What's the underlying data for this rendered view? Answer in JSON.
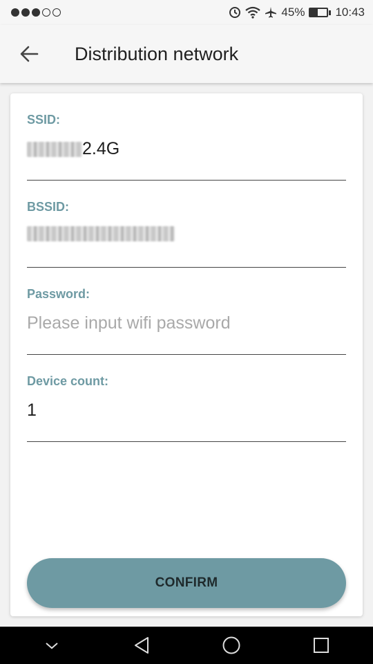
{
  "status_bar": {
    "signal_dots": [
      "filled",
      "filled",
      "filled",
      "empty",
      "empty"
    ],
    "battery_percent": "45%",
    "battery_level": 0.45,
    "time": "10:43",
    "icons": [
      "alarm-icon",
      "wifi-icon",
      "airplane-icon",
      "battery-icon"
    ]
  },
  "app_bar": {
    "title": "Distribution network",
    "back_icon": "arrow-left-icon"
  },
  "form": {
    "ssid": {
      "label": "SSID:",
      "value_suffix": "2.4G"
    },
    "bssid": {
      "label": "BSSID:"
    },
    "password": {
      "label": "Password:",
      "value": "",
      "placeholder": "Please input wifi password"
    },
    "device_count": {
      "label": "Device count:",
      "value": "1"
    }
  },
  "confirm_button": {
    "label": "CONFIRM"
  },
  "nav_bar": {
    "icons": [
      "chevron-down-icon",
      "back-triangle-icon",
      "home-circle-icon",
      "recents-square-icon"
    ]
  },
  "colors": {
    "accent": "#6e9aa3",
    "background": "#f2f2f2",
    "card": "#ffffff",
    "nav": "#000000"
  }
}
